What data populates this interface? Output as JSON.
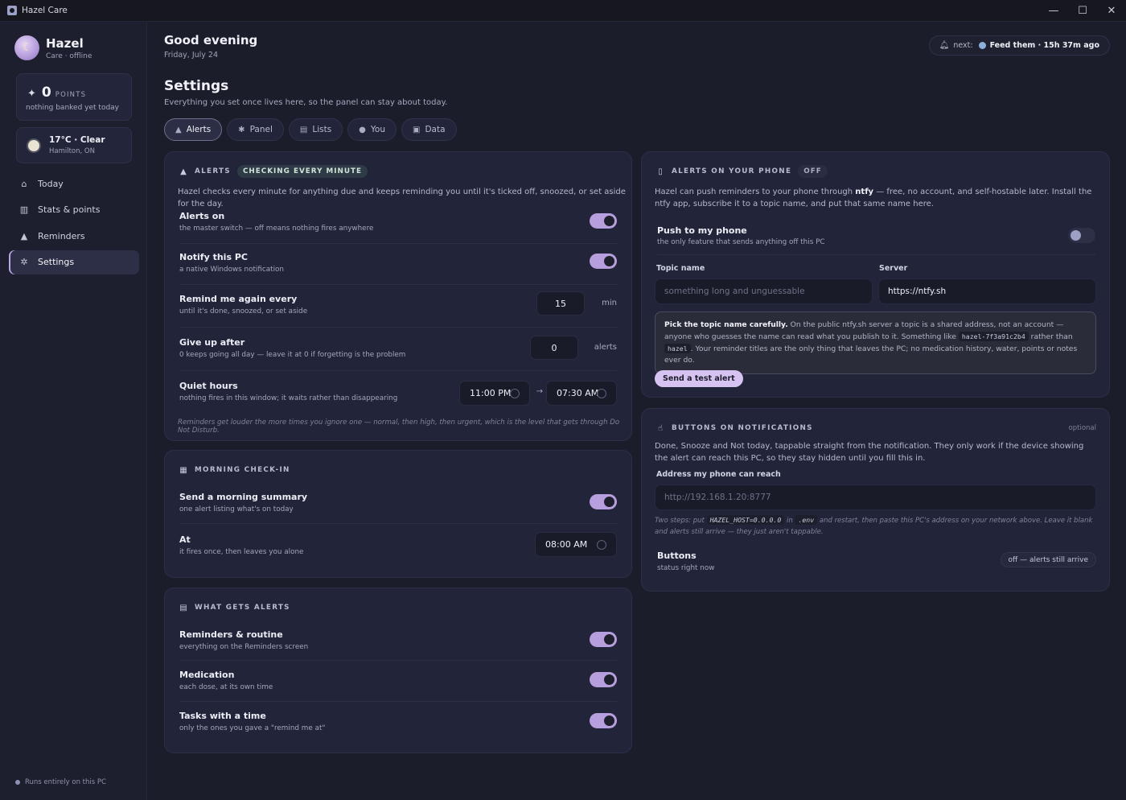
{
  "window": {
    "title": "Hazel Care",
    "controls": [
      "—",
      "☐",
      "✕"
    ]
  },
  "sidebar": {
    "profile": {
      "name": "Hazel",
      "status": "Care · offline"
    },
    "points": {
      "value": "0",
      "label": "POINTS",
      "sub": "nothing banked yet today"
    },
    "weather": {
      "summary": "17°C · Clear",
      "location": "Hamilton, ON"
    },
    "nav": [
      {
        "label": "Today",
        "icon": "house-icon"
      },
      {
        "label": "Stats & points",
        "icon": "chart-icon"
      },
      {
        "label": "Reminders",
        "icon": "bell-icon"
      },
      {
        "label": "Settings",
        "icon": "gear-icon",
        "active": true
      }
    ],
    "footer": "Runs entirely on this PC"
  },
  "header": {
    "greeting": "Good evening",
    "date": "Friday, July 24",
    "next": {
      "prefix": "next:",
      "task": "Feed them · 15h 37m ago"
    }
  },
  "settings": {
    "title": "Settings",
    "subtitle": "Everything you set once lives here, so the panel can stay about today.",
    "tabs": [
      {
        "label": "Alerts",
        "active": true
      },
      {
        "label": "Panel"
      },
      {
        "label": "Lists"
      },
      {
        "label": "You"
      },
      {
        "label": "Data"
      }
    ]
  },
  "alerts": {
    "title": "ALERTS",
    "badge": "CHECKING EVERY MINUTE",
    "desc": "Hazel checks every minute for anything due and keeps reminding you until it's ticked off, snoozed, or set aside for the day.",
    "alerts_on": {
      "label": "Alerts on",
      "sub": "the master switch — off means nothing fires anywhere",
      "on": true
    },
    "notify_pc": {
      "label": "Notify this PC",
      "sub": "a native Windows notification",
      "on": true
    },
    "remind": {
      "label": "Remind me again every",
      "sub": "until it's done, snoozed, or set aside",
      "value": "15",
      "unit": "min"
    },
    "give_up": {
      "label": "Give up after",
      "sub": "0 keeps going all day — leave it at 0 if forgetting is the problem",
      "value": "0",
      "unit": "alerts"
    },
    "quiet": {
      "label": "Quiet hours",
      "sub": "nothing fires in this window; it waits rather than disappearing",
      "start": "11:00 PM",
      "end": "07:30 AM",
      "arrow": "→"
    },
    "footnote": "Reminders get louder the more times you ignore one — normal, then high, then urgent, which is the level that gets through Do Not Disturb."
  },
  "morning": {
    "title": "MORNING CHECK-IN",
    "summary": {
      "label": "Send a morning summary",
      "sub": "one alert listing what's on today",
      "on": true
    },
    "at": {
      "label": "At",
      "sub": "it fires once, then leaves you alone",
      "time": "08:00 AM"
    }
  },
  "what_alerts": {
    "title": "WHAT GETS ALERTS",
    "items": [
      {
        "label": "Reminders & routine",
        "sub": "everything on the Reminders screen",
        "on": true
      },
      {
        "label": "Medication",
        "sub": "each dose, at its own time",
        "on": true
      },
      {
        "label": "Tasks with a time",
        "sub": "only the ones you gave a \"remind me at\"",
        "on": true
      }
    ]
  },
  "phone": {
    "title": "ALERTS ON YOUR PHONE",
    "badge": "OFF",
    "desc_pre": "Hazel can push reminders to your phone through ",
    "desc_bold": "ntfy",
    "desc_post": " — free, no account, and self-hostable later. Install the ntfy app, subscribe it to a topic name, and put that same name here.",
    "push": {
      "label": "Push to my phone",
      "sub": "the only feature that sends anything off this PC",
      "on": false
    },
    "topic": {
      "label": "Topic name",
      "placeholder": "something long and unguessable",
      "value": ""
    },
    "server": {
      "label": "Server",
      "value": "https://ntfy.sh"
    },
    "warning": {
      "bold": "Pick the topic name carefully.",
      "text1": " On the public ntfy.sh server a topic is a shared address, not an account — anyone who guesses the name can read what you publish to it. Something like ",
      "code1": "hazel-7f3a91c2b4",
      "text2": " rather than ",
      "code2": "hazel",
      "text3": ". Your reminder titles are the only thing that leaves the PC; no medication history, water, points or notes ever do."
    },
    "test_button": "Send a test alert"
  },
  "buttons_notif": {
    "title": "BUTTONS ON NOTIFICATIONS",
    "optional": "optional",
    "desc": "Done, Snooze and Not today, tappable straight from the notification. They only work if the device showing the alert can reach this PC, so they stay hidden until you fill this in.",
    "address": {
      "label": "Address my phone can reach",
      "placeholder": "http://192.168.1.20:8777",
      "value": ""
    },
    "hint": {
      "t1": "Two steps: put ",
      "c1": "HAZEL_HOST=0.0.0.0",
      "t2": " in ",
      "c2": ".env",
      "t3": " and restart, then paste this PC's address on your network above. Leave it blank and alerts still arrive — they just aren't tappable."
    },
    "status": {
      "label": "Buttons",
      "sub": "status right now",
      "value": "off — alerts still arrive"
    }
  }
}
